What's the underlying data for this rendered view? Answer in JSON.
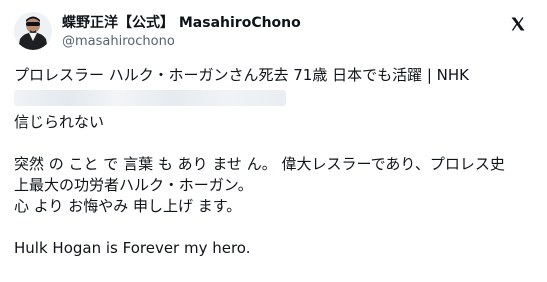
{
  "user": {
    "display_name": "蝶野正洋【公式】 MasahiroChono",
    "handle": "@masahirochono",
    "avatar_icon": "profile-photo-avatar"
  },
  "brand": {
    "logo_icon": "x-logo-icon",
    "accent_color": "#0f1419",
    "secondary_text_color": "#536471"
  },
  "tweet": {
    "headline": "プロレスラー ハルク・ホーガンさん死去 71歳 日本でも活躍 | NHK",
    "link_status": "blurred",
    "line_1": "信じられない",
    "line_2": "突然 の こと で 言葉 も あり ませ ん。 偉大レスラーであり、プロレス史",
    "line_3": "上最大の功労者ハルク・ホーガン。",
    "line_4": "心 より お悔やみ 申し上げ ます。",
    "line_5": "Hulk Hogan is Forever my hero."
  }
}
